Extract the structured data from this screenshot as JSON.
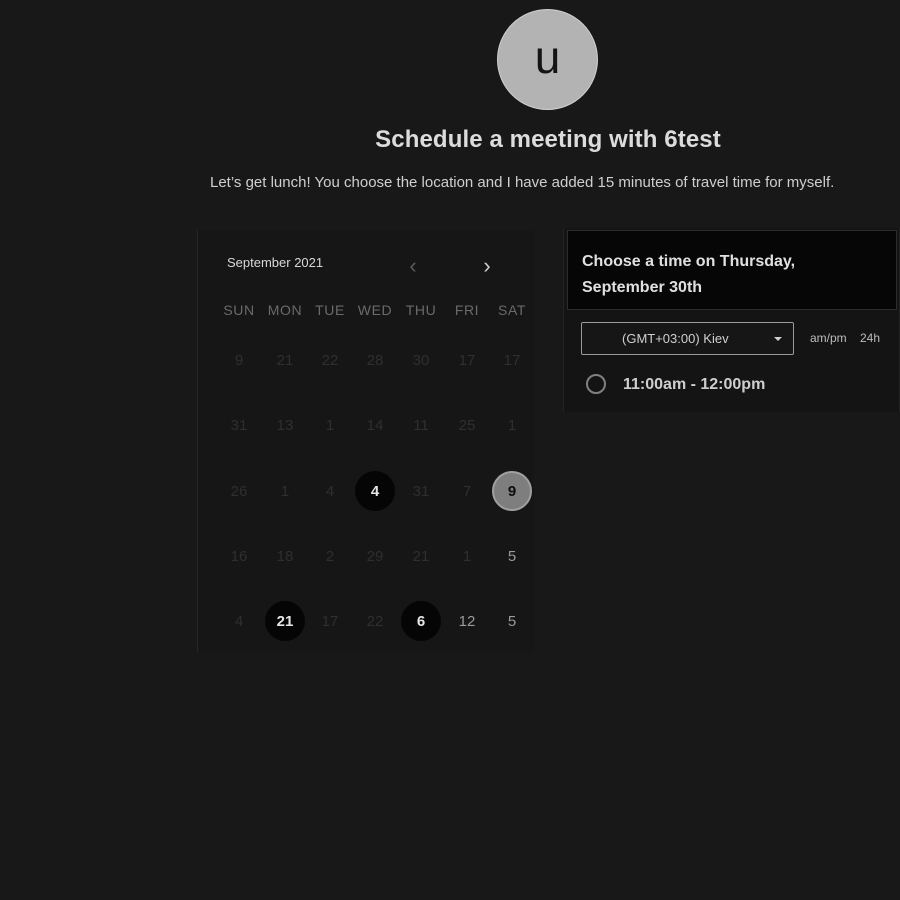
{
  "profile": {
    "avatar_letter": "u"
  },
  "header": {
    "title": "Schedule a meeting with 6test",
    "subtitle": "Let’s get lunch! You choose the location and I have added 15 minutes of travel time for myself."
  },
  "calendar": {
    "month_label": "September 2021",
    "prev_icon": "chevron-left-icon",
    "next_icon": "chevron-right-icon",
    "weekdays": [
      "SUN",
      "MON",
      "TUE",
      "WED",
      "THU",
      "FRI",
      "SAT"
    ],
    "weeks": [
      [
        {
          "label": "9",
          "state": "off"
        },
        {
          "label": "21",
          "state": "off"
        },
        {
          "label": "22",
          "state": "off"
        },
        {
          "label": "28",
          "state": "off"
        },
        {
          "label": "30",
          "state": "off"
        },
        {
          "label": "17",
          "state": "off"
        },
        {
          "label": "17",
          "state": "off"
        }
      ],
      [
        {
          "label": "31",
          "state": "off"
        },
        {
          "label": "13",
          "state": "off"
        },
        {
          "label": "1",
          "state": "off"
        },
        {
          "label": "14",
          "state": "off"
        },
        {
          "label": "11",
          "state": "off"
        },
        {
          "label": "25",
          "state": "off"
        },
        {
          "label": "1",
          "state": "off"
        }
      ],
      [
        {
          "label": "26",
          "state": "off"
        },
        {
          "label": "1",
          "state": "off"
        },
        {
          "label": "4",
          "state": "off"
        },
        {
          "label": "4",
          "state": "available"
        },
        {
          "label": "31",
          "state": "off"
        },
        {
          "label": "7",
          "state": "off"
        },
        {
          "label": "9",
          "state": "selected"
        }
      ],
      [
        {
          "label": "16",
          "state": "off"
        },
        {
          "label": "18",
          "state": "off"
        },
        {
          "label": "2",
          "state": "off"
        },
        {
          "label": "29",
          "state": "off"
        },
        {
          "label": "21",
          "state": "off"
        },
        {
          "label": "1",
          "state": "off"
        },
        {
          "label": "5",
          "state": "on"
        }
      ],
      [
        {
          "label": "4",
          "state": "off"
        },
        {
          "label": "21",
          "state": "available"
        },
        {
          "label": "17",
          "state": "off"
        },
        {
          "label": "22",
          "state": "off"
        },
        {
          "label": "6",
          "state": "available"
        },
        {
          "label": "12",
          "state": "on"
        },
        {
          "label": "5",
          "state": "on"
        }
      ]
    ]
  },
  "time_panel": {
    "heading": "Choose a time on Thursday, September 30th",
    "timezone": "(GMT+03:00) Kiev",
    "format_ampm": "am/pm",
    "format_24h": "24h",
    "slots": [
      {
        "label": "11:00am - 12:00pm"
      }
    ]
  },
  "colors": {
    "background": "#181818",
    "available_day": "#050505",
    "selected_day": "#7e7e7e"
  }
}
